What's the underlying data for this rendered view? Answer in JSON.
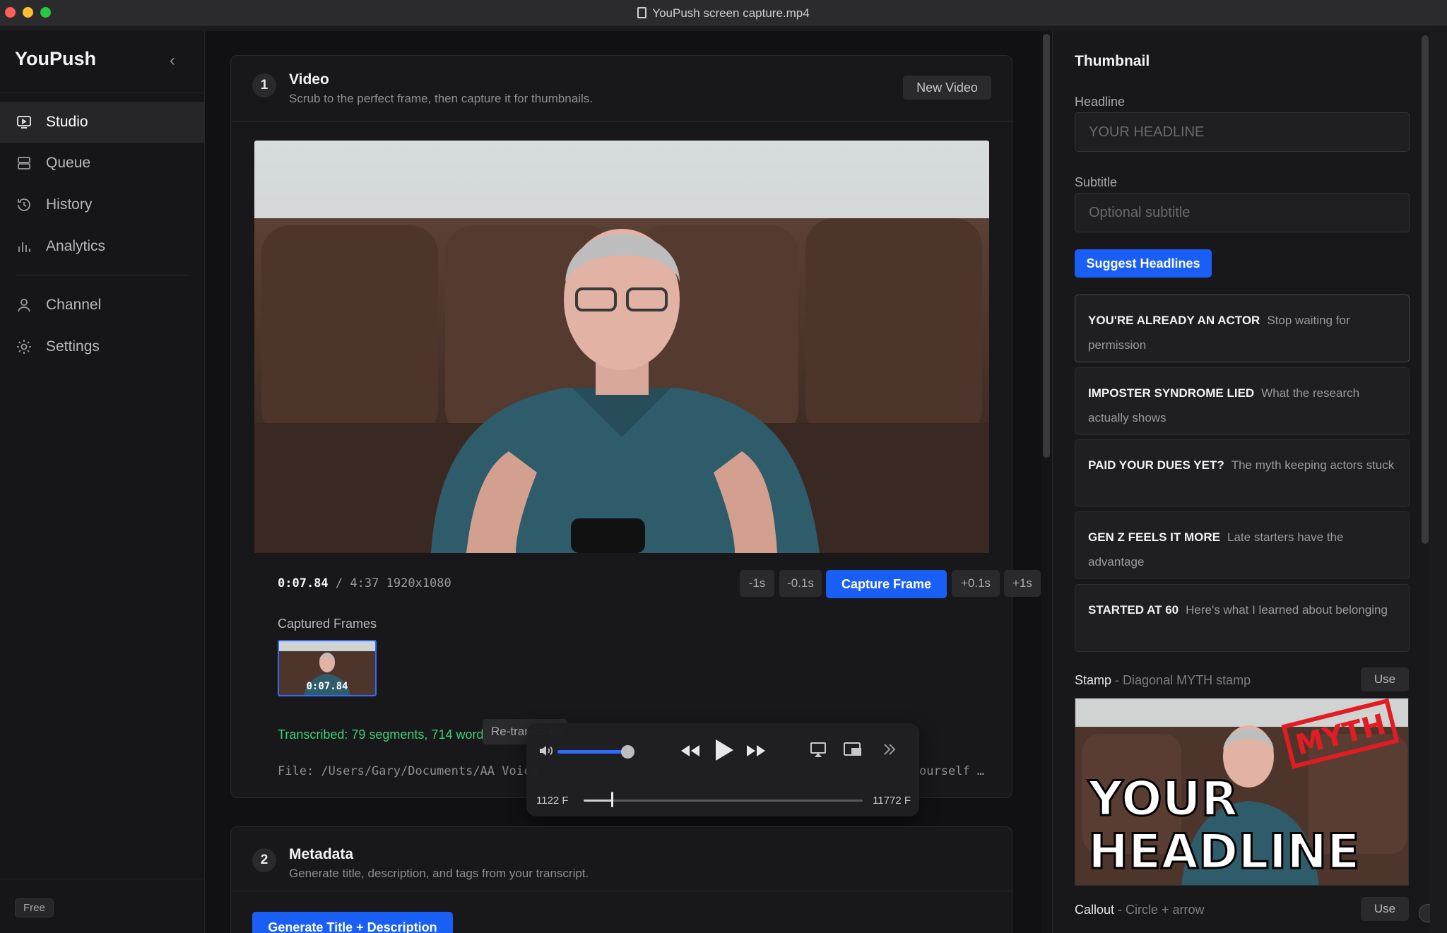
{
  "window": {
    "title": "YouPush screen capture.mp4"
  },
  "sidebar": {
    "brand": "YouPush",
    "items": [
      {
        "label": "Studio",
        "icon": "monitor-play-icon",
        "active": true
      },
      {
        "label": "Queue",
        "icon": "stack-icon"
      },
      {
        "label": "History",
        "icon": "clock-history-icon"
      },
      {
        "label": "Analytics",
        "icon": "bar-chart-icon"
      },
      {
        "label": "Channel",
        "icon": "user-icon"
      },
      {
        "label": "Settings",
        "icon": "gear-icon"
      }
    ],
    "plan": "Free"
  },
  "video_card": {
    "step": "1",
    "title": "Video",
    "subtitle": "Scrub to the perfect frame, then capture it for thumbnails.",
    "new_video": "New Video",
    "current_time": "0:07.84",
    "separator": "/",
    "duration": "4:37",
    "resolution": "1920x1080",
    "step_buttons": {
      "minus_1s": "-1s",
      "minus_01s": "-0.1s",
      "capture": "Capture Frame",
      "plus_01s": "+0.1s",
      "plus_1s": "+1s"
    },
    "captured_label": "Captured Frames",
    "captured_frames": [
      {
        "time": "0:07.84"
      }
    ],
    "transcribed": "Transcribed: 79 segments, 714 words",
    "retranscribe": "Re-transcribe",
    "file_path": "File: /Users/Gary/Documents/AA Voice (",
    "file_path_end": "ourself …"
  },
  "player": {
    "frame_start": "1122 F",
    "frame_end": "11772 F",
    "volume": 0.8,
    "progress": 0.1
  },
  "metadata_card": {
    "step": "2",
    "title": "Metadata",
    "subtitle": "Generate title, description, and tags from your transcript.",
    "generate": "Generate Title + Description"
  },
  "thumbnail": {
    "title": "Thumbnail",
    "headline_label": "Headline",
    "headline_placeholder": "YOUR HEADLINE",
    "subtitle_label": "Subtitle",
    "subtitle_placeholder": "Optional subtitle",
    "suggest": "Suggest Headlines",
    "suggestions": [
      {
        "headline": "YOU'RE ALREADY AN ACTOR",
        "sub": "Stop waiting for permission"
      },
      {
        "headline": "IMPOSTER SYNDROME LIED",
        "sub": "What the research actually shows"
      },
      {
        "headline": "PAID YOUR DUES YET?",
        "sub": "The myth keeping actors stuck"
      },
      {
        "headline": "GEN Z FEELS IT MORE",
        "sub": "Late starters have the advantage"
      },
      {
        "headline": "STARTED AT 60",
        "sub": "Here's what I learned about belonging"
      }
    ],
    "stamp": {
      "name": "Stamp",
      "desc": " - Diagonal MYTH stamp",
      "use": "Use",
      "preview_headline_1": "YOUR",
      "preview_headline_2": "HEADLINE",
      "preview_stamp": "MYTH"
    },
    "callout": {
      "name": "Callout",
      "desc": " - Circle + arrow",
      "use": "Use"
    }
  }
}
